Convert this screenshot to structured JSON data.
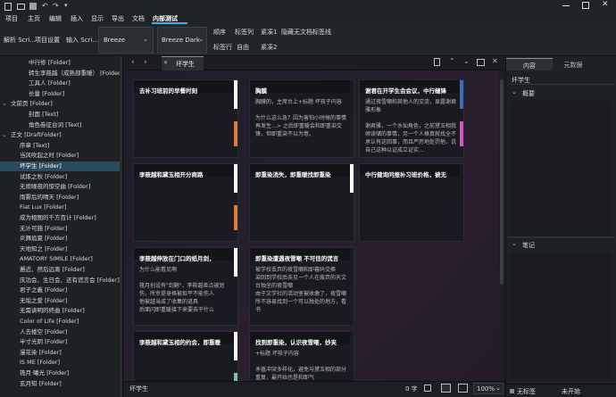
{
  "titlebar": {
    "menus": [
      "项目",
      "主页",
      "编辑",
      "插入",
      "显示",
      "导出",
      "文档",
      "内部测试"
    ],
    "active_menu": "内部测试"
  },
  "toolbar": {
    "buttons_left": [
      "解析 Scri...",
      "项目设置",
      "输入 Scri..."
    ],
    "theme_combo_1": "Breeze",
    "theme_combo_2": "Breeze Dark",
    "row1": [
      "顺序",
      "标签列",
      "紧凑1",
      "隐藏无文档标签线"
    ],
    "row2": [
      "标签行",
      "自由",
      "紧凑2"
    ]
  },
  "sidebar": {
    "rows": [
      {
        "indent": 2,
        "twisty": "",
        "label": "中行修 [Folder]"
      },
      {
        "indent": 2,
        "twisty": "",
        "label": "转生李筱越（成熟部重暖） [Folder]"
      },
      {
        "indent": 2,
        "twisty": "",
        "label": "工具人 [Folder]"
      },
      {
        "indent": 2,
        "twisty": "",
        "label": "长量 [Folder]"
      },
      {
        "indent": 0,
        "twisty": "⌄",
        "label": "文前页 [Folder]"
      },
      {
        "indent": 2,
        "twisty": "",
        "label": "封面 [Text]"
      },
      {
        "indent": 2,
        "twisty": "",
        "label": "角色卷征台词 [Text]"
      },
      {
        "indent": 0,
        "twisty": "⌄",
        "label": "正文 [DraftFolder]"
      },
      {
        "indent": 1,
        "twisty": "",
        "label": "序章 [Text]"
      },
      {
        "indent": 1,
        "twisty": "",
        "label": "当风吹起之时 [Folder]"
      },
      {
        "indent": 1,
        "twisty": "",
        "label": "坏学生 [Folder]"
      },
      {
        "indent": 1,
        "twisty": "",
        "label": "试炼之秋 [Folder]"
      },
      {
        "indent": 1,
        "twisty": "",
        "label": "无烦噪夜的惊空曲 [Folder]"
      },
      {
        "indent": 1,
        "twisty": "",
        "label": "雨雾后的晴天 [Folder]"
      },
      {
        "indent": 1,
        "twisty": "",
        "label": "Fiat Lux [Folder]"
      },
      {
        "indent": 1,
        "twisty": "",
        "label": "成为相图的千方百计 [Folder]"
      },
      {
        "indent": 1,
        "twisty": "",
        "label": "无计可施 [Folder]"
      },
      {
        "indent": 1,
        "twisty": "",
        "label": "炎舞焰夏 [Folder]"
      },
      {
        "indent": 1,
        "twisty": "",
        "label": "天地知之 [Folder]"
      },
      {
        "indent": 1,
        "twisty": "",
        "label": "AMATORY SIMILE [Folder]"
      },
      {
        "indent": 1,
        "twisty": "",
        "label": "邂近、然后远离 [Folder]"
      },
      {
        "indent": 1,
        "twisty": "",
        "label": "庆功会、生日会、还有谎言会 [Folder]"
      },
      {
        "indent": 1,
        "twisty": "",
        "label": "君子之義 [Folder]"
      },
      {
        "indent": 1,
        "twisty": "",
        "label": "无垢之爱 [Folder]"
      },
      {
        "indent": 1,
        "twisty": "",
        "label": "无需讲明的终曲 [Folder]"
      },
      {
        "indent": 1,
        "twisty": "",
        "label": "Color of Life [Folder]"
      },
      {
        "indent": 1,
        "twisty": "",
        "label": "人去楼空 [Folder]"
      },
      {
        "indent": 1,
        "twisty": "",
        "label": "半寸光阴 [Folder]"
      },
      {
        "indent": 1,
        "twisty": "",
        "label": "漫花染 [Folder]"
      },
      {
        "indent": 1,
        "twisty": "",
        "label": "IS ME [Folder]"
      },
      {
        "indent": 1,
        "twisty": "",
        "label": "筏月·曦光 [Folder]"
      },
      {
        "indent": 1,
        "twisty": "",
        "label": "玄月知 [Folder]"
      }
    ],
    "selected_index": 10
  },
  "editor": {
    "tab_label": "坏学生",
    "cards": [
      {
        "title": "去补习班前的早餐时刻",
        "body": "",
        "stripe": "#ffffff",
        "stripe2": "#e07b39"
      },
      {
        "title": "胸膜",
        "body": "胸膜的，主席台上+标题 坏孩子内容\n\n为什么这么急？因为害怕小时候的事情再发生…> 之后即重暖会和即重染交锋，但即重染不以为意。",
        "stripe": "",
        "stripe2": ""
      },
      {
        "title": "谢君在开学生会会议，中行缝锋",
        "body": "通过夜雪嘲和其他人的交流，显露谢君雅形象\n\n谢君雅，一个水仙角色，之前黛玉相我倾读储的事情，另一个人格真就找全不承认有这回事，而且严厉地处罚他，说自己这种以证成立证实…",
        "stripe": "#3b6fb5",
        "stripe2": "#d455c4"
      },
      {
        "title": "李筱越和黛玉相开分商路",
        "body": "",
        "stripe": "#ffffff",
        "stripe2": "#e07b39"
      },
      {
        "title": "即重染消失，即重暖找即重染",
        "body": "",
        "stripe": "#ffffff",
        "stripe2": ""
      },
      {
        "title": "中行健询问报补习班价格，被无",
        "body": "",
        "stripe": "",
        "stripe2": ""
      },
      {
        "title": "李筱越伸放在门口的纸月剑，",
        "body": "为什么能看见啊\n\n筏月创设有\"剑鞘\"，李筱越差点被划伤，所幸提身格被拟平不能伤人\n他被越当成了收集的道具\n后面闪即重暖接下来要去干什么",
        "stripe": "#ffffff",
        "stripe2": ""
      },
      {
        "title": "即重染遭遇夜雪嘲 不可信的谎言",
        "body": "被学校丢弃的夜雪嘲和即暮码交换\n染回到学校后去见一个人在废弃的天文台独坐的夜雪嘲\n由于文学社的活动室被收缴了，夜雪嘲所不容易找到一个可以独处的地方，看书",
        "stripe": "",
        "stripe2": ""
      },
      {
        "title": "李筱越和黛玉相的约会，即重暖",
        "body": "",
        "stripe": "#ffffff",
        "stripe2": "#7fbfa8"
      },
      {
        "title": "找到即重染，认识夜雪嘲，妙夹",
        "body": "+标题 坏孩子内容\n\n矛盾冲突多样化，避免与黛玉相的部分重复，最开始也是和即气",
        "stripe": "",
        "stripe2": ""
      }
    ]
  },
  "inspector": {
    "tabs": [
      "内容",
      "元数据"
    ],
    "title_field": "坏学生",
    "section_summary": "概要",
    "section_notes": "笔记"
  },
  "statusbar": {
    "left": "坏学生",
    "word_count": "0 字",
    "zoom": "100%",
    "label_status": "无标签",
    "progress": "未开始"
  }
}
